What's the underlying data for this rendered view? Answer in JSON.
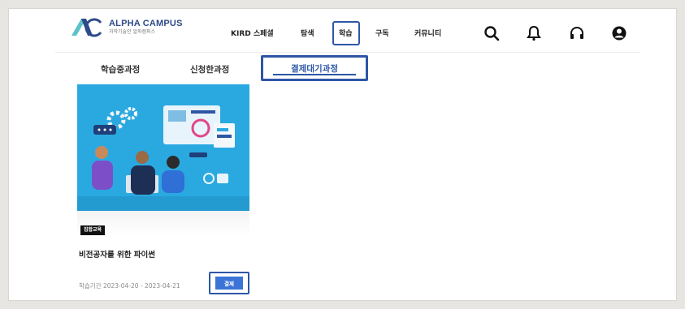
{
  "header": {
    "brand": {
      "name": "ALPHA CAMPUS",
      "subtitle": "과학기술인 알파캠퍼스"
    },
    "nav": [
      {
        "label": "KIRD 스페셜"
      },
      {
        "label": "탐색"
      },
      {
        "label": "학습",
        "highlighted": true
      },
      {
        "label": "구독"
      },
      {
        "label": "커뮤니티"
      }
    ],
    "icons": [
      "search-icon",
      "bell-icon",
      "headset-icon",
      "user-icon"
    ]
  },
  "subtabs": [
    {
      "label": "학습중과정"
    },
    {
      "label": "신청한과정"
    },
    {
      "label": "결제대기과정",
      "active": true
    }
  ],
  "course": {
    "category": "집합교육",
    "title": "비전공자를 위한 파이썬",
    "period": "학습기간  2023-04-20 - 2023-04-21",
    "pay_label": "결제"
  },
  "colors": {
    "accent": "#2d56a6",
    "pay_button": "#3b74d6",
    "thumbnail_bg": "#2aa9e1"
  }
}
